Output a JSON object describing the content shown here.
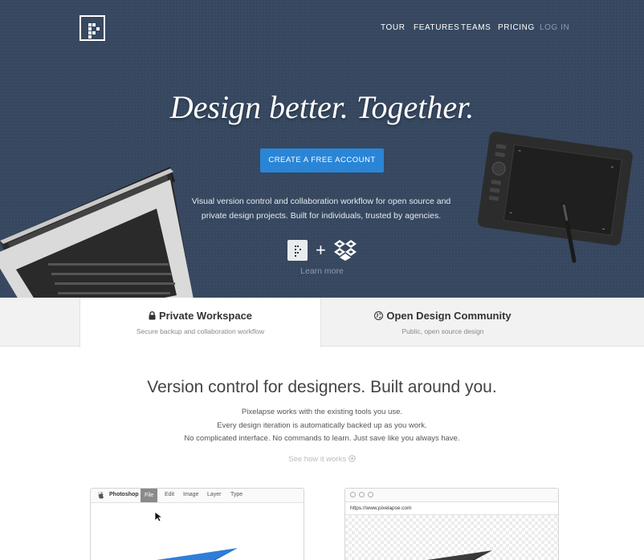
{
  "nav": {
    "items": [
      "TOUR",
      "FEATURES",
      "TEAMS",
      "PRICING"
    ],
    "login": "LOG IN"
  },
  "hero": {
    "headline": "Design better. Together.",
    "cta": "CREATE A FREE ACCOUNT",
    "subtext_line1": "Visual version control and collaboration workflow for open source and",
    "subtext_line2": "private design projects. Built for individuals, trusted by agencies.",
    "plus": "+",
    "learn_more": "Learn more"
  },
  "tabs": [
    {
      "title": "Private Workspace",
      "subtitle": "Secure backup and collaboration workflow",
      "icon": "lock-icon"
    },
    {
      "title": "Open Design Community",
      "subtitle": "Public, open source design",
      "icon": "globe-icon"
    }
  ],
  "main": {
    "title": "Version control for designers. Built around you.",
    "line1": "Pixelapse works with the existing tools you use.",
    "line2": "Every design iteration is automatically backed up as you work.",
    "line3": "No complicated interface. No commands to learn. Just save like you always have.",
    "see_how": "See how it works"
  },
  "photoshop": {
    "app": "Photoshop",
    "menus": [
      "File",
      "Edit",
      "Image",
      "Layer",
      "Type"
    ]
  },
  "browser": {
    "url": "https://www.pixelapse.com"
  },
  "colors": {
    "hero_bg": "#36475f",
    "cta": "#2a85d6",
    "plane_blue": "#2f7ed8",
    "plane_dark": "#3a3a3a"
  }
}
